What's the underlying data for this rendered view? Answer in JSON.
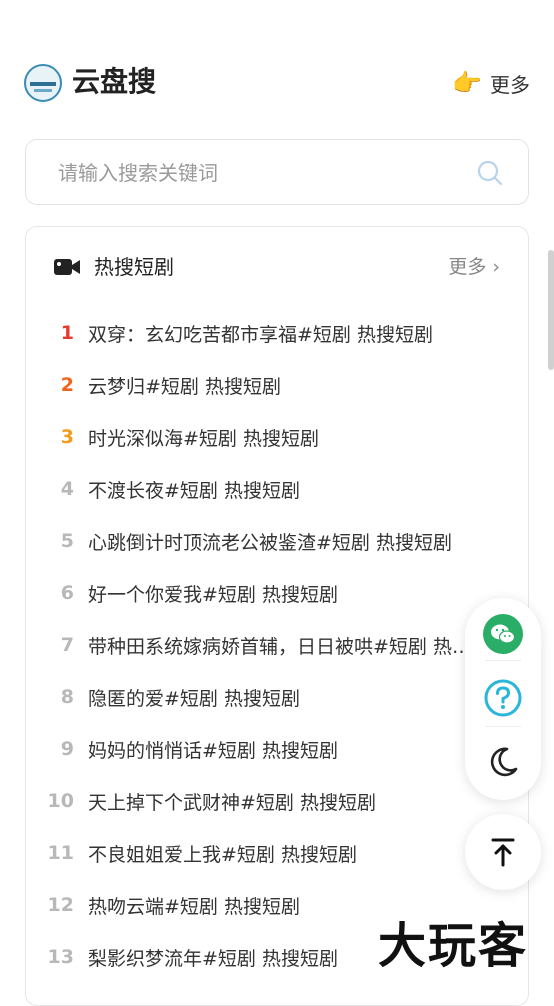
{
  "header": {
    "title": "云盘搜",
    "more_label": "更多"
  },
  "search": {
    "placeholder": "请输入搜索关键词"
  },
  "hot": {
    "title": "热搜短剧",
    "more_label": "更多 ›",
    "items": [
      {
        "rank": "1",
        "text": "双穿：玄幻吃苦都市享福#短剧 热搜短剧"
      },
      {
        "rank": "2",
        "text": "云梦归#短剧 热搜短剧"
      },
      {
        "rank": "3",
        "text": "时光深似海#短剧 热搜短剧"
      },
      {
        "rank": "4",
        "text": "不渡长夜#短剧 热搜短剧"
      },
      {
        "rank": "5",
        "text": "心跳倒计时顶流老公被鉴渣#短剧 热搜短剧"
      },
      {
        "rank": "6",
        "text": "好一个你爱我#短剧 热搜短剧"
      },
      {
        "rank": "7",
        "text": "带种田系统嫁病娇首辅，日日被哄#短剧 热搜短剧"
      },
      {
        "rank": "8",
        "text": "隐匿的爱#短剧 热搜短剧"
      },
      {
        "rank": "9",
        "text": "妈妈的悄悄话#短剧 热搜短剧"
      },
      {
        "rank": "10",
        "text": "天上掉下个武财神#短剧 热搜短剧"
      },
      {
        "rank": "11",
        "text": "不良姐姐爱上我#短剧 热搜短剧"
      },
      {
        "rank": "12",
        "text": "热吻云端#短剧 热搜短剧"
      },
      {
        "rank": "13",
        "text": "梨影织梦流年#短剧 热搜短剧"
      }
    ]
  },
  "watermark": "大玩客",
  "colors": {
    "rank1": "#e83a2c",
    "rank2": "#f0631e",
    "rank3": "#f39b1c",
    "wechat": "#2aae67",
    "help": "#29b6d8"
  }
}
